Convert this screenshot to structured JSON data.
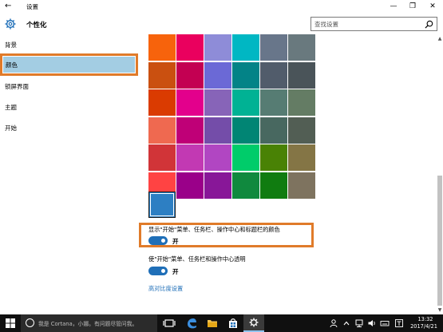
{
  "window": {
    "title": "设置",
    "back_glyph": "←",
    "minimize_glyph": "—",
    "maximize_glyph": "❐",
    "close_glyph": "✕"
  },
  "header": {
    "title": "个性化",
    "search_placeholder": "查找设置"
  },
  "sidebar": {
    "items": [
      {
        "label": "背景",
        "selected": false
      },
      {
        "label": "颜色",
        "selected": true
      },
      {
        "label": "锁屏界面",
        "selected": false
      },
      {
        "label": "主题",
        "selected": false
      },
      {
        "label": "开始",
        "selected": false
      }
    ]
  },
  "colors": {
    "grid": [
      [
        "#f7630c",
        "#ea005e",
        "#8e8cd8",
        "#00b7c3",
        "#68768a",
        "#69797e"
      ],
      [
        "#ca5010",
        "#c30052",
        "#6b69d6",
        "#038387",
        "#515c6b",
        "#4a5459"
      ],
      [
        "#da3b01",
        "#e3008c",
        "#8764b8",
        "#00b294",
        "#567c73",
        "#647c64"
      ],
      [
        "#ef6950",
        "#bf0077",
        "#744da9",
        "#018574",
        "#486860",
        "#525e54"
      ],
      [
        "#d13438",
        "#c239b3",
        "#b146c2",
        "#00cc6a",
        "#498205",
        "#847545"
      ],
      [
        "#ff4343",
        "#9a0089",
        "#881798",
        "#10893e",
        "#107c10",
        "#7e735f"
      ]
    ],
    "selected": "#2d7fc3",
    "accent": "#1f6fb8",
    "highlight": "#e07b2a"
  },
  "options": {
    "show_color": {
      "label": "显示\"开始\"菜单、任务栏、操作中心和标题栏的颜色",
      "state": "开"
    },
    "transparency": {
      "label": "使\"开始\"菜单、任务栏和操作中心透明",
      "state": "开"
    },
    "contrast_link": "高对比度设置"
  },
  "scrollbar": {
    "up_glyph": "▲",
    "down_glyph": "▼"
  },
  "taskbar": {
    "cortana_placeholder": "我是 Cortana，小娜。有问题尽管问我。",
    "time": "13:32",
    "date": "2017/4/21"
  }
}
